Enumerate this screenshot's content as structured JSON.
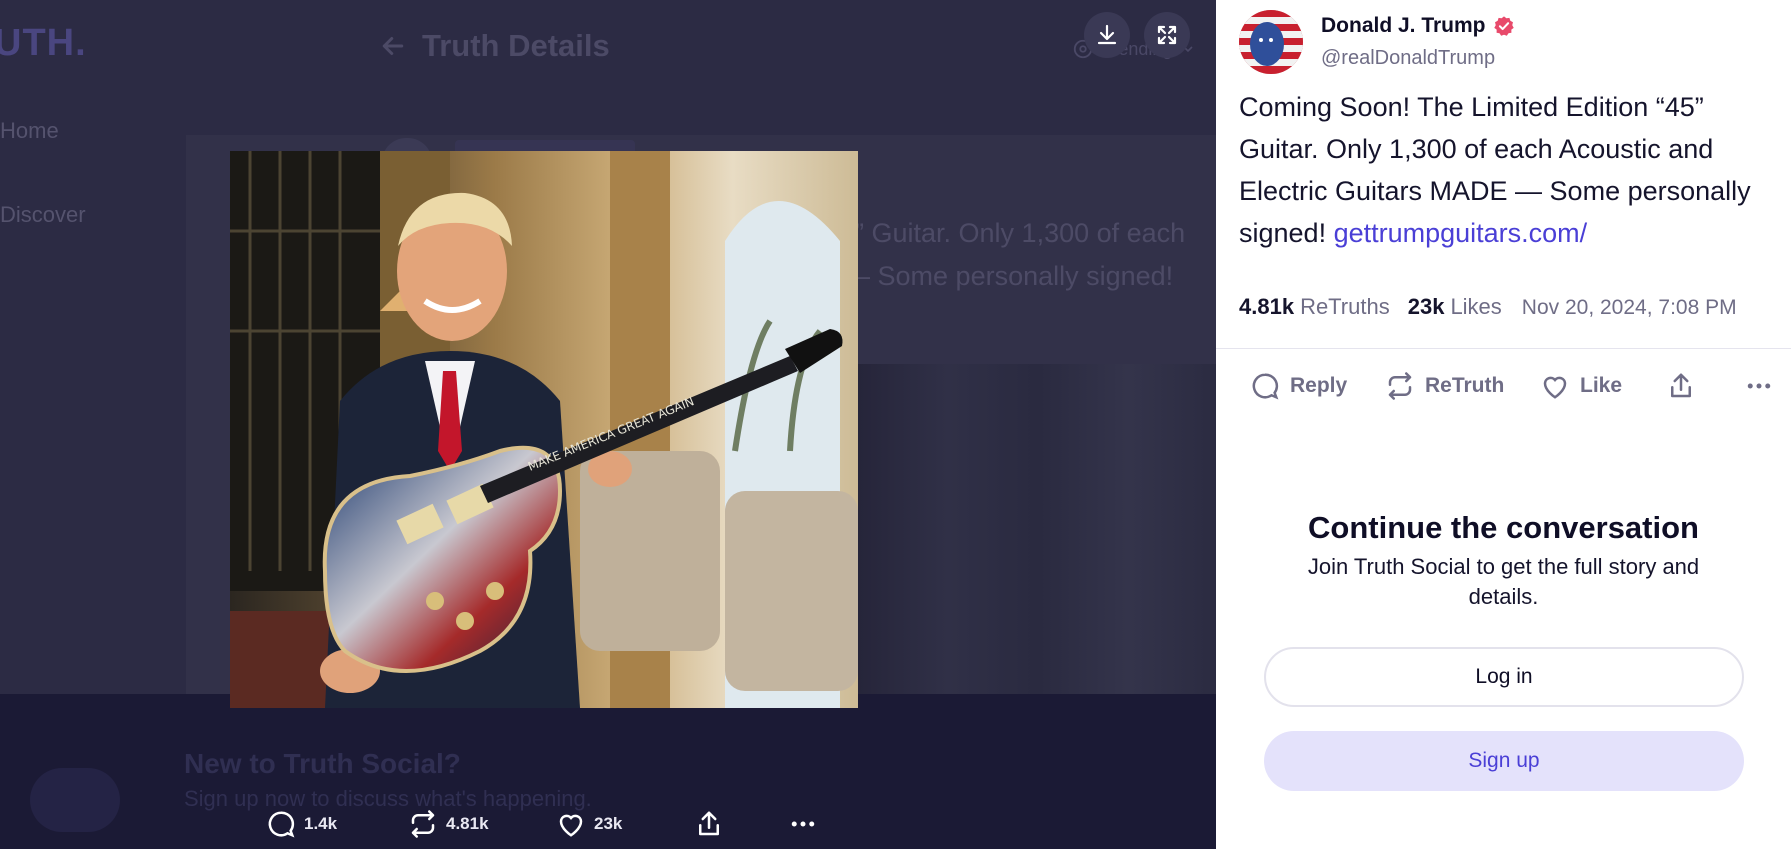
{
  "background": {
    "logo": "UTH.",
    "nav": [
      "Home",
      "Discover"
    ],
    "page_title": "Truth Details",
    "trending_label": "Trending",
    "post_line1": "” Guitar. Only 1,300 of each",
    "post_line2": "– Some personally signed!",
    "footer_title": "New to Truth Social?",
    "footer_sub": "Sign up now to discuss what's happening."
  },
  "media_viewer": {
    "download_icon": "download-icon",
    "fullscreen_icon": "fullscreen-icon",
    "guitar_inlay_text": "MAKE AMERICA GREAT AGAIN",
    "actions": {
      "replies": "1.4k",
      "retruths": "4.81k",
      "likes": "23k"
    }
  },
  "panel": {
    "author_name": "Donald J. Trump",
    "author_handle": "@realDonaldTrump",
    "post_text": "Coming Soon! The Limited Edition “45” Guitar. Only 1,300 of each Acoustic and Electric Guitars MADE — Some personally signed! ",
    "post_link": "gettrumpguitars.com/",
    "stats": {
      "retruths_count": "4.81k",
      "retruths_label": "ReTruths",
      "likes_count": "23k",
      "likes_label": "Likes",
      "timestamp": "Nov 20, 2024, 7:08 PM"
    },
    "actions": {
      "reply": "Reply",
      "retruth": "ReTruth",
      "like": "Like"
    },
    "cta": {
      "title": "Continue the conversation",
      "subtitle": "Join Truth Social to get the full story and details.",
      "login": "Log in",
      "signup": "Sign up"
    }
  },
  "colors": {
    "accent": "#4a3fd6",
    "verified": "#e84a6b",
    "overlay": "#2c2b44"
  }
}
